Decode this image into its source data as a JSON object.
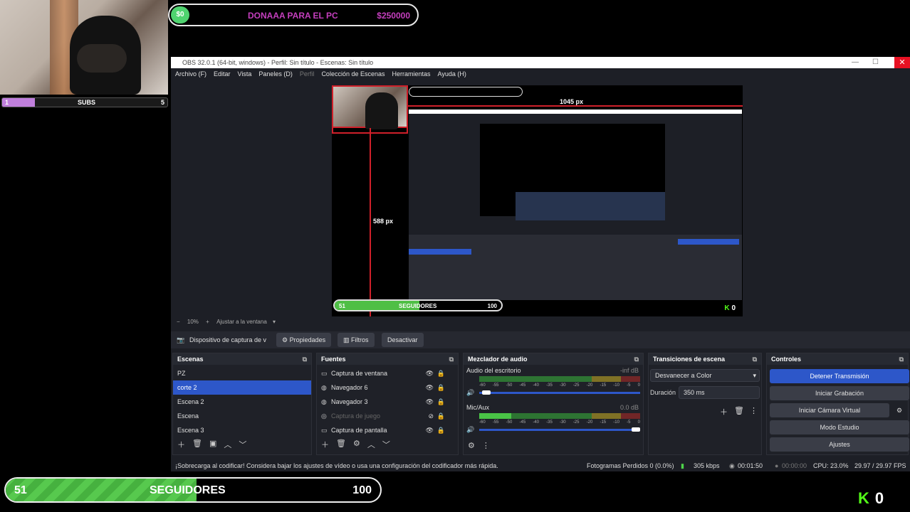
{
  "overlay": {
    "subs": {
      "current": "1",
      "label": "SUBS",
      "goal": "5",
      "progress": 0.2
    },
    "donation": {
      "current": "$0",
      "title": "DONAAA PARA EL PC",
      "goal": "$250000"
    },
    "followers": {
      "current": "51",
      "label": "SEGUIDORES",
      "goal": "100",
      "progress": 0.51
    },
    "kick": {
      "logo": "K",
      "count": "0"
    }
  },
  "obs": {
    "title": "OBS 32.0.1 (64-bit, windows) - Perfil: Sin título - Escenas: Sin título",
    "menu": [
      "Archivo (F)",
      "Editar",
      "Vista",
      "Paneles (D)",
      "Perfil",
      "Colección de Escenas",
      "Herramientas",
      "Ayuda (H)"
    ],
    "preview": {
      "width_label": "1045 px",
      "height_label": "588 px",
      "nested_followers": {
        "current": "51",
        "label": "SEGUIDORES",
        "goal": "100"
      },
      "kick_count": "0"
    },
    "zoom": {
      "percent": "10%",
      "mode": "Ajustar a la ventana"
    },
    "source_toolbar": {
      "source_name": "Dispositivo de captura de v",
      "properties": "Propiedades",
      "filters": "Filtros",
      "deactivate": "Desactivar"
    },
    "scenes": {
      "header": "Escenas",
      "items": [
        "PZ",
        "corte 2",
        "Escena 2",
        "Escena",
        "Escena 3"
      ],
      "selected": 1
    },
    "sources": {
      "header": "Fuentes",
      "items": [
        {
          "label": "Captura de ventana",
          "icon": "window-icon",
          "enabled": true
        },
        {
          "label": "Navegador 6",
          "icon": "globe-icon",
          "enabled": true
        },
        {
          "label": "Navegador 3",
          "icon": "globe-icon",
          "enabled": true
        },
        {
          "label": "Captura de juego",
          "icon": "gamepad-icon",
          "enabled": false
        },
        {
          "label": "Captura de pantalla",
          "icon": "monitor-icon",
          "enabled": true
        }
      ]
    },
    "mixer": {
      "header": "Mezclador de audio",
      "channels": [
        {
          "name": "Audio del escritorio",
          "db": "-inf dB",
          "level": 0.0,
          "volume": 0.02
        },
        {
          "name": "Mic/Aux",
          "db": "0.0 dB",
          "level": 0.2,
          "volume": 1.0
        }
      ],
      "ticks": [
        "-60",
        "-55",
        "-50",
        "-45",
        "-40",
        "-35",
        "-30",
        "-25",
        "-20",
        "-15",
        "-10",
        "-5",
        "0"
      ]
    },
    "transitions": {
      "header": "Transiciones de escena",
      "selected": "Desvanecer a Color",
      "duration_label": "Duración",
      "duration_value": "350 ms"
    },
    "controls": {
      "header": "Controles",
      "stop_stream": "Detener Transmisión",
      "start_recording": "Iniciar Grabación",
      "start_virtual_cam": "Iniciar Cámara Virtual",
      "studio_mode": "Modo Estudio",
      "settings": "Ajustes"
    },
    "status": {
      "message": "¡Sobrecarga al codificar! Considera bajar los ajustes de vídeo o usa una configuración del codificador más rápida.",
      "dropped": "Fotogramas Perdidos 0 (0.0%)",
      "bitrate": "305 kbps",
      "stream_time": "00:01:50",
      "rec_time": "00:00:00",
      "cpu": "CPU: 23.0%",
      "fps": "29.97 / 29.97 FPS"
    },
    "colors": {
      "accent": "#2d57c9",
      "bg": "#1d1f26",
      "red_guide": "#d0202a",
      "kick_green": "#53fc18"
    }
  }
}
